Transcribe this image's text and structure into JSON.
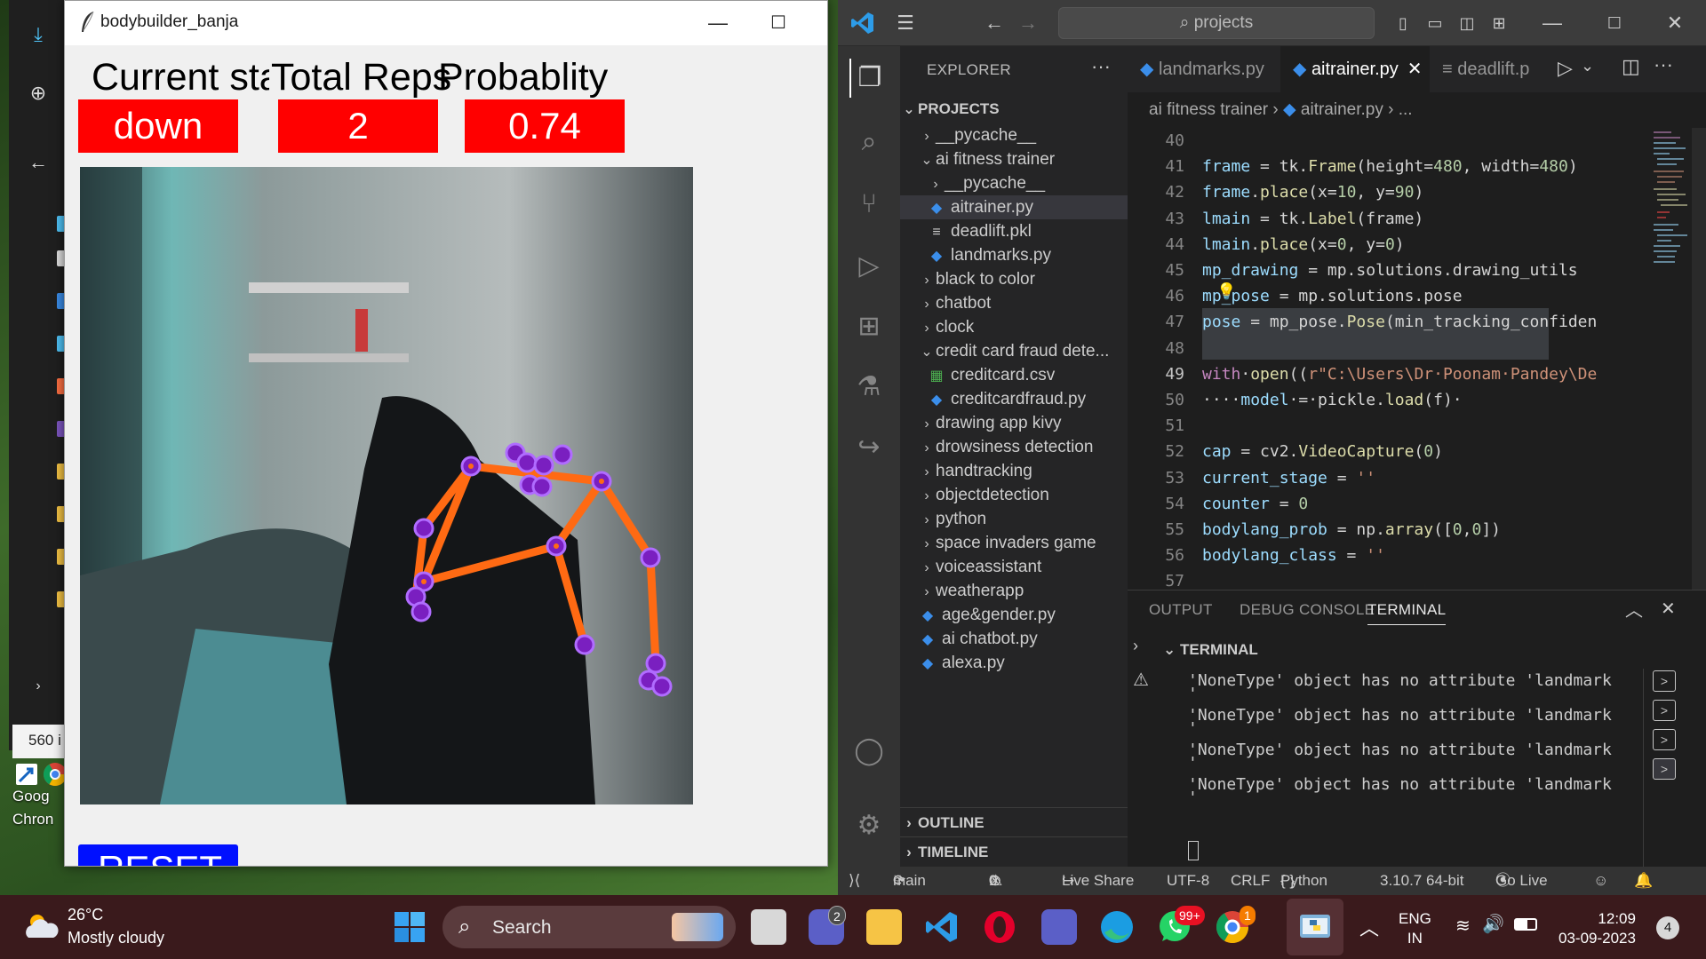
{
  "tk_window": {
    "title": "bodybuilder_banja",
    "headers": [
      "Current sta",
      "Total Reps",
      "Probablity"
    ],
    "stage_value": "down",
    "reps_value": "2",
    "prob_value": "0.74",
    "reset_label": "RESET"
  },
  "bg_window": {
    "counter": "560 i",
    "desktop_label": "Goog Chron"
  },
  "vscode": {
    "search": "projects",
    "explorer_title": "EXPLORER",
    "projects_label": "PROJECTS",
    "tree": [
      {
        "label": "__pycache__",
        "type": "folder",
        "open": false,
        "indent": 1
      },
      {
        "label": "ai fitness trainer",
        "type": "folder",
        "open": true,
        "indent": 1
      },
      {
        "label": "__pycache__",
        "type": "folder",
        "open": false,
        "indent": 2
      },
      {
        "label": "aitrainer.py",
        "type": "py",
        "indent": 2,
        "selected": true
      },
      {
        "label": "deadlift.pkl",
        "type": "file",
        "indent": 2
      },
      {
        "label": "landmarks.py",
        "type": "py",
        "indent": 2
      },
      {
        "label": "black to color",
        "type": "folder",
        "open": false,
        "indent": 1
      },
      {
        "label": "chatbot",
        "type": "folder",
        "open": false,
        "indent": 1
      },
      {
        "label": "clock",
        "type": "folder",
        "open": false,
        "indent": 1
      },
      {
        "label": "credit card fraud dete...",
        "type": "folder",
        "open": true,
        "indent": 1
      },
      {
        "label": "creditcard.csv",
        "type": "csv",
        "indent": 2
      },
      {
        "label": "creditcardfraud.py",
        "type": "py",
        "indent": 2
      },
      {
        "label": "drawing app kivy",
        "type": "folder",
        "open": false,
        "indent": 1
      },
      {
        "label": "drowsiness detection",
        "type": "folder",
        "open": false,
        "indent": 1
      },
      {
        "label": "handtracking",
        "type": "folder",
        "open": false,
        "indent": 1
      },
      {
        "label": "objectdetection",
        "type": "folder",
        "open": false,
        "indent": 1
      },
      {
        "label": "python",
        "type": "folder",
        "open": false,
        "indent": 1
      },
      {
        "label": "space invaders game",
        "type": "folder",
        "open": false,
        "indent": 1
      },
      {
        "label": "voiceassistant",
        "type": "folder",
        "open": false,
        "indent": 1
      },
      {
        "label": "weatherapp",
        "type": "folder",
        "open": false,
        "indent": 1
      },
      {
        "label": "age&gender.py",
        "type": "py",
        "indent": 1
      },
      {
        "label": "ai chatbot.py",
        "type": "py",
        "indent": 1
      },
      {
        "label": "alexa.py",
        "type": "py",
        "indent": 1
      }
    ],
    "outline_label": "OUTLINE",
    "timeline_label": "TIMELINE",
    "tabs": [
      {
        "label": "landmarks.py",
        "active": false
      },
      {
        "label": "aitrainer.py",
        "active": true
      },
      {
        "label": "deadlift.p",
        "active": false
      }
    ],
    "breadcrumb": [
      "ai fitness trainer",
      "aitrainer.py",
      "..."
    ],
    "code_lines": [
      {
        "n": "40",
        "t": ""
      },
      {
        "n": "41",
        "t": "frame = tk.Frame(height=480, width=480)"
      },
      {
        "n": "42",
        "t": "frame.place(x=10, y=90)"
      },
      {
        "n": "43",
        "t": "lmain = tk.Label(frame)"
      },
      {
        "n": "44",
        "t": "lmain.place(x=0, y=0)"
      },
      {
        "n": "45",
        "t": "mp_drawing = mp.solutions.drawing_utils"
      },
      {
        "n": "46",
        "t": "mp_pose = mp.solutions.pose"
      },
      {
        "n": "47",
        "t": "pose = mp_pose.Pose(min_tracking_confiden"
      },
      {
        "n": "48",
        "t": ""
      },
      {
        "n": "49",
        "t": "with·open((r\"C:\\Users\\Dr·Poonam·Pandey\\De"
      },
      {
        "n": "50",
        "t": "····model·=·pickle.load(f)·"
      },
      {
        "n": "51",
        "t": ""
      },
      {
        "n": "52",
        "t": "cap = cv2.VideoCapture(0)"
      },
      {
        "n": "53",
        "t": "current_stage = ''"
      },
      {
        "n": "54",
        "t": "counter = 0"
      },
      {
        "n": "55",
        "t": "bodylang_prob = np.array([0,0])"
      },
      {
        "n": "56",
        "t": "bodylang_class = ''"
      },
      {
        "n": "57",
        "t": ""
      }
    ],
    "panel_tabs": [
      "OUTPUT",
      "DEBUG CONSOLE",
      "TERMINAL"
    ],
    "terminal_header": "TERMINAL",
    "terminal_lines": [
      "'NoneType' object has no attribute 'landmark",
      "'",
      "'NoneType' object has no attribute 'landmark",
      "'",
      "'NoneType' object has no attribute 'landmark",
      "'",
      "'NoneType' object has no attribute 'landmark",
      "'"
    ],
    "status": {
      "branch": "main",
      "errors": "0",
      "warnings": "0",
      "live_share": "Live Share",
      "encoding": "UTF-8",
      "eol": "CRLF",
      "language": "Python",
      "interpreter": "3.10.7 64-bit",
      "go_live": "Go Live"
    }
  },
  "taskbar": {
    "temperature": "26°C",
    "weather": "Mostly cloudy",
    "search_placeholder": "Search",
    "badges": {
      "teams_meet": "2",
      "whatsapp": "99+",
      "chrome": "1"
    },
    "lang_line1": "ENG",
    "lang_line2": "IN",
    "time": "12:09",
    "date": "03-09-2023",
    "notifications": "4"
  },
  "colors": {
    "stage_box": "#ff0000",
    "reset_button": "#0010ff",
    "skeleton_line": "#ff6a13",
    "skeleton_joint": "#7a1fc0",
    "vscode_accent": "#007acc",
    "taskbar": "#3a1a1c"
  }
}
